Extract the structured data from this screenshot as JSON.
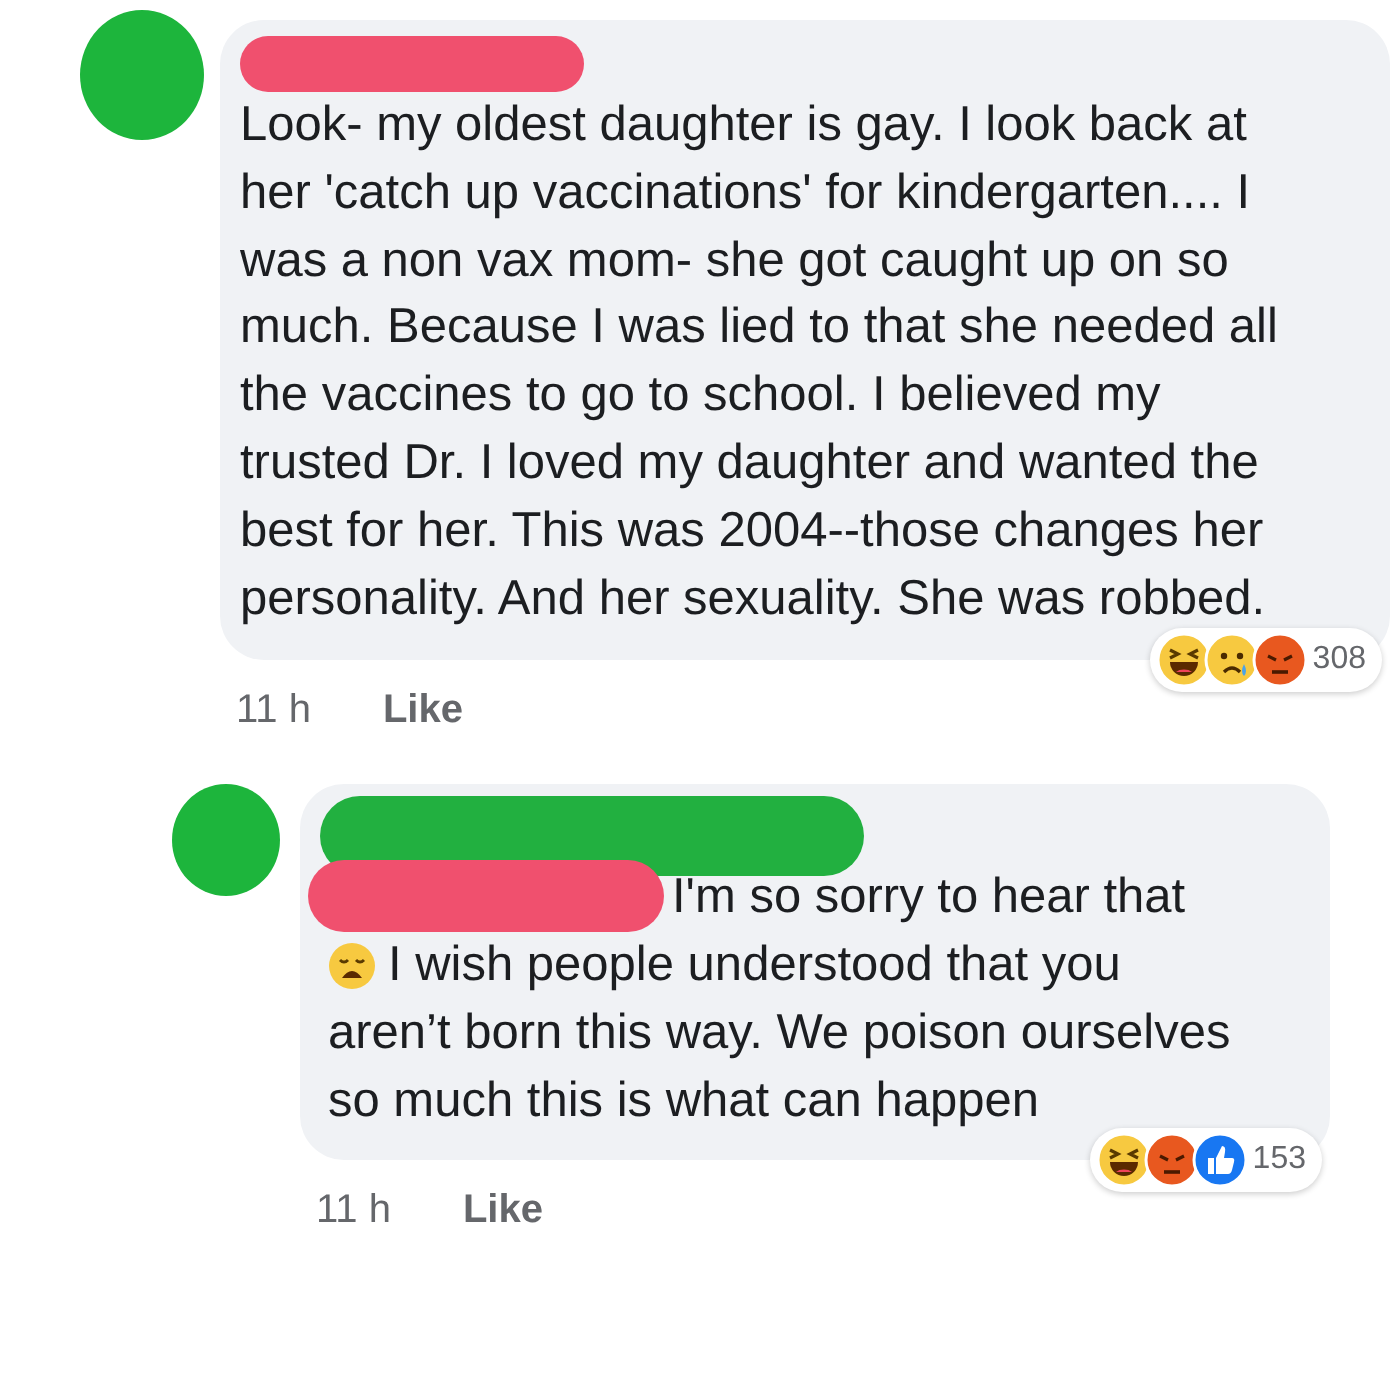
{
  "comments": [
    {
      "redacted": true,
      "parts": [
        {
          "kind": "text",
          "text": "Look- my oldest daughter is gay. I look back at her 'catch up vaccinations' for kindergarten.... I was a non vax mom- she got caught up on so much. Because I was lied to that she needed all the vaccines to go to school. I believed my trusted Dr. I loved my daughter and wanted the best for her. This was 2004--those changes her personality. And her sexuality. She was robbed."
        }
      ],
      "time": "11 h",
      "action": "Like",
      "reactions": [
        {
          "kind": "haha"
        },
        {
          "kind": "sad"
        },
        {
          "kind": "angry"
        }
      ],
      "reaction_count": "308"
    },
    {
      "redacted": true,
      "parts": [
        {
          "kind": "text",
          "text": "I'm so sorry to hear that"
        },
        {
          "kind": "emoji"
        },
        {
          "kind": "text",
          "text": "I wish people understood that you"
        },
        {
          "kind": "text",
          "text": "aren’t born this way. We poison ourselves so much this is what can happen"
        }
      ],
      "time": "11 h",
      "action": "Like",
      "reactions": [
        {
          "kind": "haha"
        },
        {
          "kind": "angry"
        },
        {
          "kind": "like"
        }
      ],
      "reaction_count": "153"
    }
  ]
}
